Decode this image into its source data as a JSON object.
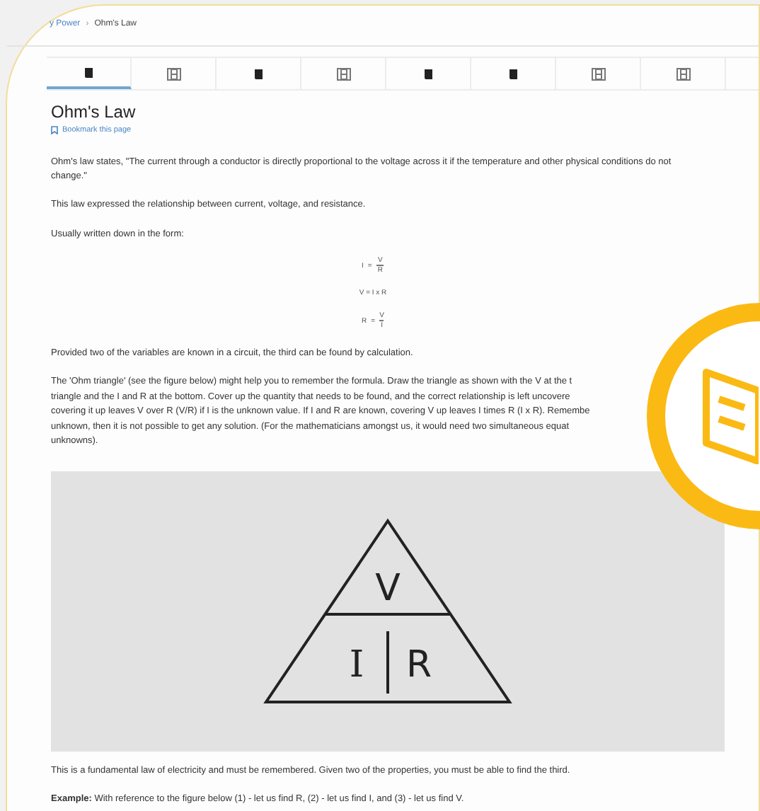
{
  "breadcrumb": [
    {
      "label": "y Power",
      "link": true
    },
    {
      "label": "Ohm's Law",
      "link": false
    }
  ],
  "breadcrumb_separator": "›",
  "tabs": [
    {
      "kind": "book",
      "selected": true
    },
    {
      "kind": "film",
      "selected": false
    },
    {
      "kind": "book",
      "selected": false
    },
    {
      "kind": "film",
      "selected": false
    },
    {
      "kind": "book",
      "selected": false
    },
    {
      "kind": "book",
      "selected": false
    },
    {
      "kind": "film",
      "selected": false
    },
    {
      "kind": "film",
      "selected": false
    }
  ],
  "title": "Ohm's Law",
  "bookmark": "Bookmark this page",
  "paragraphs_top": [
    "Ohm's law states, \"The current through a conductor is directly proportional to the voltage across it if the temperature and other physical conditions do not change.\"",
    "This law expressed the relationship between current, voltage, and resistance.",
    "Usually written down in the form:"
  ],
  "formulas": [
    {
      "kind": "fraction",
      "left": "I",
      "op": "=",
      "num": "V",
      "den": "R"
    },
    {
      "kind": "product",
      "text": "V = I x R"
    },
    {
      "kind": "fraction",
      "left": "R",
      "op": "=",
      "num": "V",
      "den": "I"
    }
  ],
  "paragraph_calc": "Provided two of the variables are known in a circuit, the third can be found by calculation.",
  "paragraph_triangle_lines": [
    "The 'Ohm triangle' (see the figure below) might help you to remember the formula. Draw the triangle as shown with the V at the t",
    "triangle and the I and R at the bottom. Cover up the quantity that needs to be found, and the correct relationship is left uncovere",
    "covering it up leaves V over R (V/R) if I is the unknown value. If I and R are known, covering V up leaves I times R (I x R). Remembe",
    "unknown, then it is not possible to get any solution. (For the mathematicians amongst us, it would need two simultaneous equat",
    "unknowns)."
  ],
  "figure": {
    "top": "V",
    "bottom_left": "I",
    "bottom_right": "R"
  },
  "paragraph_fundamental": "This is a fundamental law of electricity and must be remembered. Given two of the properties, you must be able to find the third.",
  "example": "**Example:** With reference to the figure below (1) - let us find R, (2) - let us find I, and (3) - let us find V."
}
